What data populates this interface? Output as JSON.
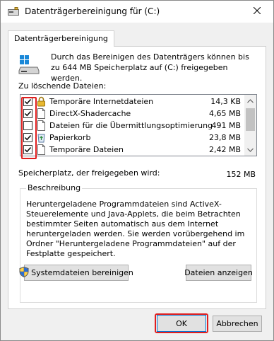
{
  "window": {
    "title": "Datenträgerbereinigung für  (C:)"
  },
  "tabs": [
    {
      "label": "Datenträgerbereinigung"
    }
  ],
  "intro": {
    "text": "Durch das Bereinigen des Datenträgers können bis zu 644 MB Speicherplatz auf  (C:) freigegeben werden."
  },
  "file_list": {
    "label": "Zu löschende Dateien:",
    "items": [
      {
        "name": "Temporäre Internetdateien",
        "size": "14,3 KB",
        "checked": true,
        "icon": "lock-icon"
      },
      {
        "name": "DirectX-Shadercache",
        "size": "4,65 MB",
        "checked": true,
        "icon": "file-icon"
      },
      {
        "name": "Dateien für die Übermittlungsoptimierung",
        "size": "491 MB",
        "checked": false,
        "icon": "file-icon"
      },
      {
        "name": "Papierkorb",
        "size": "23,8 MB",
        "checked": true,
        "icon": "recycle-bin-icon"
      },
      {
        "name": "Temporäre Dateien",
        "size": "2,42 MB",
        "checked": true,
        "icon": "file-icon"
      }
    ]
  },
  "freed": {
    "label": "Speicherplatz, der freigegeben wird:",
    "value": "152 MB"
  },
  "description": {
    "legend": "Beschreibung",
    "text": "Heruntergeladene Programmdateien sind ActiveX-Steuerelemente und Java-Applets, die beim Betrachten bestimmter Seiten automatisch aus dem Internet heruntergeladen werden. Sie werden vorübergehend im Ordner \"Heruntergeladene Programmdateien\" auf der Festplatte gespeichert."
  },
  "buttons": {
    "system_cleanup": "Systemdateien bereinigen",
    "view_files": "Dateien anzeigen",
    "ok": "OK",
    "cancel": "Abbrechen"
  },
  "colors": {
    "highlight": "#e01e1e",
    "accent": "#0078d7"
  }
}
